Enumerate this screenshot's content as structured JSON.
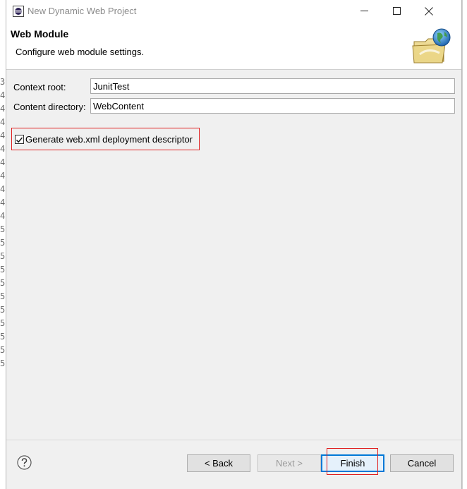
{
  "window": {
    "title": "New Dynamic Web Project"
  },
  "header": {
    "title": "Web Module",
    "description": "Configure web module settings.",
    "icon": "web-folder-globe-icon"
  },
  "form": {
    "context_root": {
      "label": "Context root:",
      "value": "JunitTest"
    },
    "content_directory": {
      "label": "Content directory:",
      "value": "WebContent"
    },
    "generate_descriptor": {
      "label": "Generate web.xml deployment descriptor",
      "checked": true
    }
  },
  "footer": {
    "help_icon": "question-mark-icon",
    "back_label": "< Back",
    "next_label": "Next >",
    "finish_label": "Finish",
    "cancel_label": "Cancel"
  },
  "background": {
    "gutter_digits": [
      "3",
      "4",
      "4",
      "4",
      "4",
      "4",
      "4",
      "4",
      "4",
      "4",
      "4",
      "5",
      "5",
      "5",
      "5",
      "5",
      "5",
      "5",
      "5",
      "5",
      "5",
      "5"
    ]
  },
  "colors": {
    "highlight_box": "#e02020",
    "default_button_border": "#0078d7"
  }
}
